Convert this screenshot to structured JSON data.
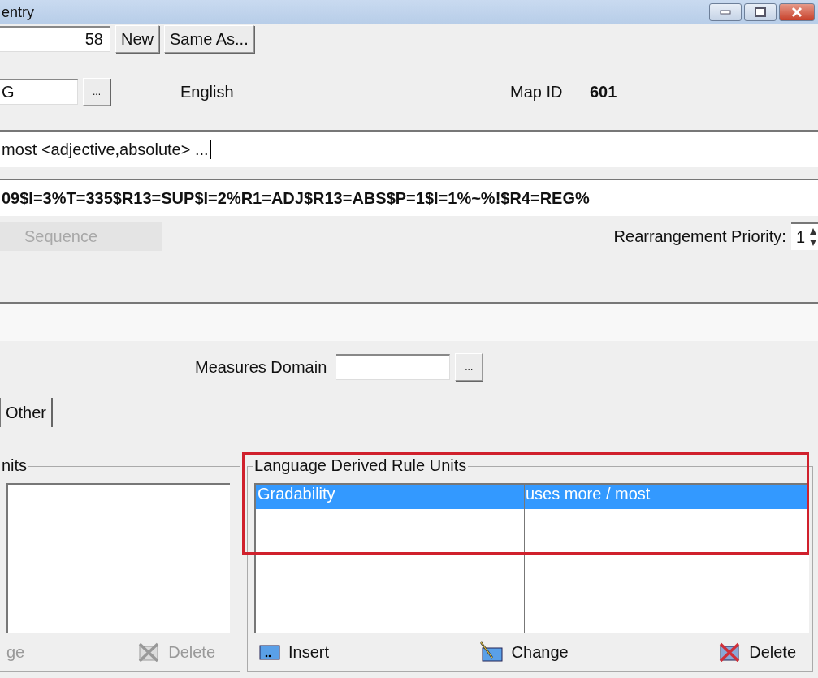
{
  "window": {
    "title": "entry"
  },
  "record": {
    "number": "58",
    "buttons": [
      "New",
      "Same As..."
    ]
  },
  "language": {
    "code": "G",
    "browse": "...",
    "name": "English",
    "map_id_label": "Map ID",
    "map_id": "601"
  },
  "description": {
    "value": "most <adjective,absolute> ..."
  },
  "code": {
    "value": "09$I=3%T=335$R13=SUP$I=2%R1=ADJ$R13=ABS$P=1$I=1%~%!$R4=REG%"
  },
  "sequence": {
    "label": "Sequence",
    "disabled": true
  },
  "priority": {
    "label": "Rearrangement Priority:",
    "value": "1"
  },
  "measures_domain": {
    "label": "Measures Domain",
    "browse": "..."
  },
  "tabs": [
    {
      "label": "Other"
    }
  ],
  "left_group": {
    "title": "nits",
    "buttons": [
      {
        "label": "ge",
        "kind": "plain",
        "disabled": true
      },
      {
        "label": "Delete",
        "kind": "delete",
        "disabled": true
      }
    ]
  },
  "right_group": {
    "title": "Language Derived Rule Units",
    "rows": [
      {
        "cells": [
          "Gradability",
          "uses more / most"
        ],
        "selected": true
      }
    ],
    "buttons": [
      {
        "label": "Insert",
        "kind": "insert",
        "disabled": false
      },
      {
        "label": "Change",
        "kind": "change",
        "disabled": false
      },
      {
        "label": "Delete",
        "kind": "delete",
        "disabled": false
      }
    ]
  }
}
